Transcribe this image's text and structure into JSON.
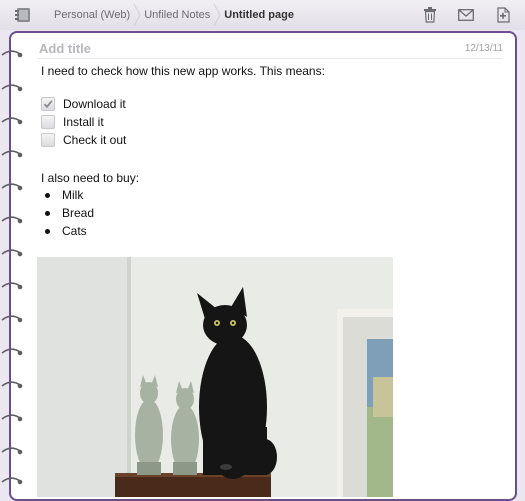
{
  "breadcrumb": {
    "notebook": "Personal (Web)",
    "section": "Unfiled Notes",
    "page": "Untitled page"
  },
  "toolbar": {
    "icons": [
      "notebooks-icon",
      "trash-icon",
      "mail-icon",
      "new-page-icon"
    ]
  },
  "note": {
    "title_placeholder": "Add title",
    "date": "12/13/11",
    "intro": "I need to check how this new app works. This means:",
    "todos": [
      {
        "label": "Download it",
        "checked": true
      },
      {
        "label": "Install it",
        "checked": false
      },
      {
        "label": "Check it out",
        "checked": false
      }
    ],
    "buy_heading": "I also need to buy:",
    "buy_items": [
      "Milk",
      "Bread",
      "Cats"
    ]
  },
  "colors": {
    "page_border": "#6a4f8c",
    "background": "#ebe7f0"
  }
}
